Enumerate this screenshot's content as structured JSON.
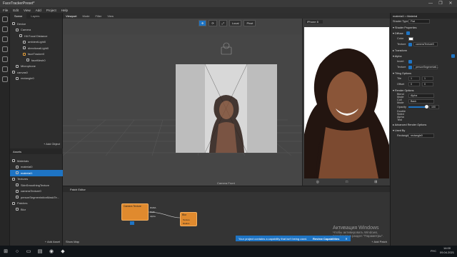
{
  "window": {
    "title": "FaceTrackerPreset*",
    "controls": [
      "—",
      "❐",
      "✕"
    ]
  },
  "menu": [
    "File",
    "Edit",
    "View",
    "Add",
    "Project",
    "Help"
  ],
  "scene": {
    "tabs": [
      "Scene",
      "Layers"
    ],
    "tree": [
      {
        "label": "Device",
        "indent": 0,
        "icon": "device-icon"
      },
      {
        "label": "Camera",
        "indent": 1,
        "icon": "camera-icon"
      },
      {
        "label": "Hit Focal Distance",
        "indent": 2,
        "icon": "focal-distance-icon"
      },
      {
        "label": "ambientLight0",
        "indent": 3,
        "icon": "light-icon"
      },
      {
        "label": "directionalLight0",
        "indent": 3,
        "icon": "light-icon"
      },
      {
        "label": "faceTracker0",
        "indent": 3,
        "icon": "face-tracker-icon",
        "highlight": true
      },
      {
        "label": "faceMesh0",
        "indent": 4,
        "icon": "mesh-icon"
      },
      {
        "label": "Microphone",
        "indent": 1,
        "icon": "microphone-icon"
      },
      {
        "label": "canvas0",
        "indent": 0,
        "icon": "canvas-icon"
      },
      {
        "label": "rectangle0",
        "indent": 1,
        "icon": "rectangle-icon"
      }
    ],
    "add_object": "+ Add Object"
  },
  "assets": {
    "title": "Assets",
    "add_asset": "+ Add Asset",
    "tree": [
      {
        "label": "Materials",
        "indent": 0,
        "icon": "folder-icon"
      },
      {
        "label": "material0",
        "indent": 1,
        "icon": "material-icon"
      },
      {
        "label": "material1",
        "indent": 1,
        "icon": "material-icon",
        "selected": true
      },
      {
        "label": "Textures",
        "indent": 0,
        "icon": "folder-icon"
      },
      {
        "label": "SkinSmoothingTexture",
        "indent": 1,
        "icon": "texture-icon"
      },
      {
        "label": "cameraTexture0",
        "indent": 1,
        "icon": "texture-icon"
      },
      {
        "label": "personSegmentationMaskTe...",
        "indent": 1,
        "icon": "texture-icon"
      },
      {
        "label": "Patches",
        "indent": 0,
        "icon": "folder-icon"
      },
      {
        "label": "Blur",
        "indent": 1,
        "icon": "patch-icon"
      }
    ]
  },
  "viewport": {
    "tabs": [
      "Viewport",
      "Mode",
      "Filter",
      "View"
    ],
    "toolbar": [
      "✥",
      "⟳",
      "⤢",
      "Local",
      "Pivot"
    ],
    "camera_label": "Camera Front",
    "device": "iPhone 8",
    "sim_controls": [
      "◎",
      "□",
      "⊞"
    ]
  },
  "inspector": {
    "title": "material1",
    "subtitle": "• Material",
    "shader_type": {
      "label": "Shader Type",
      "value": "Flat"
    },
    "sections": [
      {
        "kind": "sect",
        "label": "▾ Shader Properties"
      },
      {
        "kind": "sect",
        "label": "  ▾ Diffuse",
        "check": true
      },
      {
        "kind": "color",
        "label": "Color"
      },
      {
        "kind": "field",
        "label": "Texture",
        "value": "cameraTexture0",
        "check": true
      },
      {
        "kind": "sect",
        "label": "  ▸ Transform"
      },
      {
        "kind": "sect",
        "label": "  ▾ Alpha",
        "rcheck": true
      },
      {
        "kind": "check",
        "label": "Invert"
      },
      {
        "kind": "field",
        "label": "Texture",
        "value": "personSegmentati...",
        "check": true
      },
      {
        "kind": "sect",
        "label": "▾ Tiling Options"
      },
      {
        "kind": "pair",
        "label": "Tile",
        "a": "1",
        "b": "1"
      },
      {
        "kind": "pair",
        "label": "Offset",
        "a": "0",
        "b": "0"
      },
      {
        "kind": "sect",
        "label": "▾ Render Options"
      },
      {
        "kind": "field",
        "label": "Blend Mode",
        "value": "Alpha"
      },
      {
        "kind": "field",
        "label": "Cull Mode",
        "value": "Back"
      },
      {
        "kind": "slider",
        "label": "Opacity",
        "value": "100"
      },
      {
        "kind": "plain",
        "label": "Double Sided"
      },
      {
        "kind": "plain",
        "label": "  Alpha Test"
      },
      {
        "kind": "sect",
        "label": "▸ Advanced Render Options"
      },
      {
        "kind": "sect",
        "label": "▾ Used By"
      },
      {
        "kind": "field",
        "label": "Rectangle",
        "value": "rectangle0"
      }
    ]
  },
  "patch_editor": {
    "title": "Patch Editor",
    "node1": {
      "title": "Camera Texture",
      "ports": [
        "RGBA",
        "RGB",
        "Alpha"
      ]
    },
    "node2": {
      "title": "Blur",
      "ports": [
        "Texture",
        "Radius"
      ]
    },
    "notice": {
      "text": "Your project contains a capability that isn't being used.",
      "action": "Review Capabilities",
      "close": "✕"
    },
    "show_map": "Show Map",
    "add_patch": "+ Add Patch"
  },
  "activation": {
    "line1": "Активация Windows",
    "line2": "Чтобы активировать Windows, перейдите в раздел \"Параметры\"."
  },
  "taskbar": {
    "time": "14:00",
    "date": "09.04.2021",
    "lang": "РУС"
  },
  "colors": {
    "accent": "#1e74c4",
    "node": "#e08a2e"
  }
}
